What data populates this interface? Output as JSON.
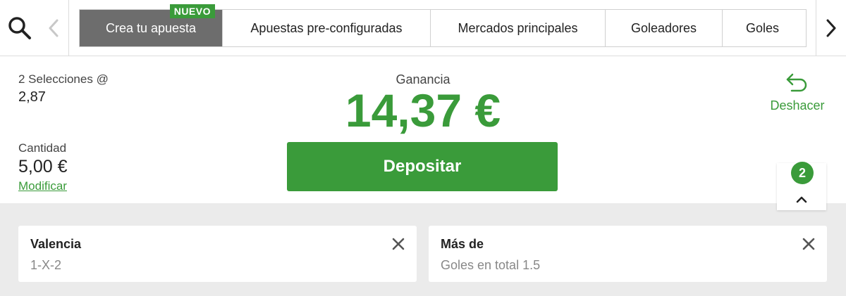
{
  "nav": {
    "search_icon": "search-icon",
    "prev_icon": "chevron-left-icon",
    "next_icon": "chevron-right-icon",
    "tabs": [
      {
        "label": "Crea tu apuesta",
        "badge": "NUEVO",
        "active": true
      },
      {
        "label": "Apuestas pre-configuradas"
      },
      {
        "label": "Mercados principales"
      },
      {
        "label": "Goleadores"
      },
      {
        "label": "Goles"
      }
    ]
  },
  "summary": {
    "selections_label": "2 Selecciones @",
    "odds": "2,87",
    "amount_label": "Cantidad",
    "amount": "5,00 €",
    "modify_label": "Modificar",
    "winnings_label": "Ganancia",
    "winnings": "14,37 €",
    "deposit_label": "Depositar",
    "undo_label": "Deshacer",
    "undo_icon": "undo-arrow-icon",
    "count": "2",
    "collapse_icon": "chevron-up-icon"
  },
  "selections": [
    {
      "title": "Valencia",
      "market": "1-X-2"
    },
    {
      "title": "Más de",
      "market": "Goles en total 1.5"
    }
  ],
  "colors": {
    "accent_green": "#3a9b3a",
    "active_tab_bg": "#6d6d6d",
    "gray_bg": "#ebebeb"
  }
}
